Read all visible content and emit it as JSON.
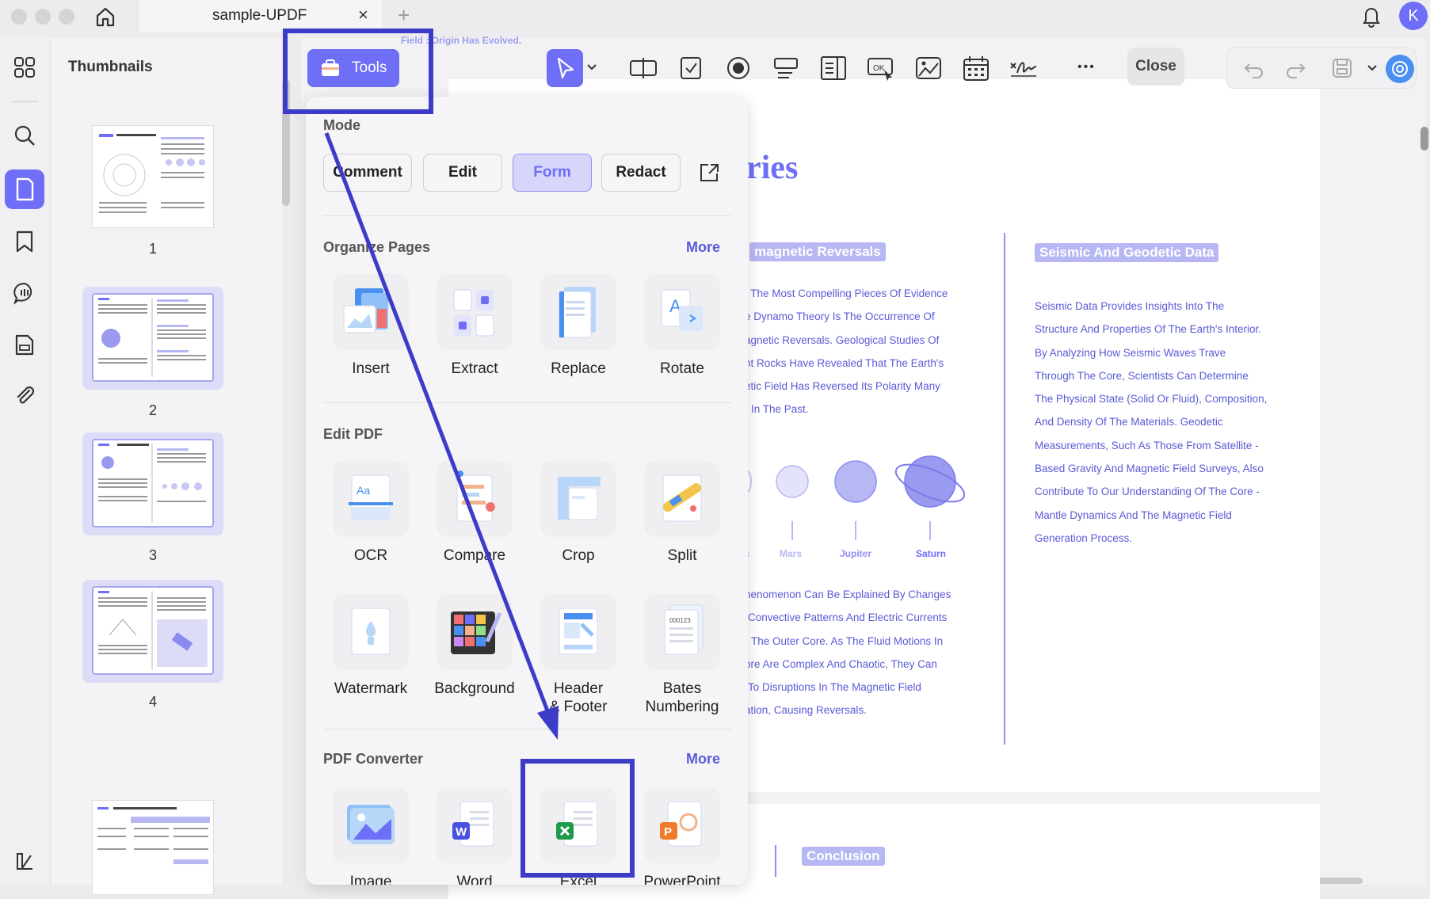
{
  "titlebar": {
    "tab_title": "sample-UPDF",
    "tab_close": "×",
    "new_tab": "+",
    "avatar_letter": "K"
  },
  "thumbnails": {
    "title": "Thumbnails",
    "pages": [
      "1",
      "2",
      "3",
      "4"
    ]
  },
  "toolbar": {
    "tools_label": "Tools",
    "close_label": "Close",
    "more_dots": "•••"
  },
  "panel": {
    "mode_title": "Mode",
    "modes": [
      "Comment",
      "Edit",
      "Form",
      "Redact"
    ],
    "selected_mode": "Form",
    "organize_title": "Organize Pages",
    "organize_more": "More",
    "organize_tools": [
      "Insert",
      "Extract",
      "Replace",
      "Rotate"
    ],
    "edit_title": "Edit PDF",
    "edit_tools_row1": [
      "OCR",
      "Compare",
      "Crop",
      "Split"
    ],
    "edit_tools_row2": [
      "Watermark",
      "Background",
      "Header\n& Footer",
      "Bates\nNumbering"
    ],
    "converter_title": "PDF Converter",
    "converter_more": "More",
    "converter_tools": [
      "Image",
      "Word",
      "Excel",
      "PowerPoint"
    ]
  },
  "document": {
    "partial_top": "Field : Origin Has Evolved.",
    "heading_partial": "ries",
    "left_banner": "magnetic Reversals",
    "left_text": [
      "f The Most Compelling Pieces Of Evidence",
      "e Dynamo Theory Is The Occurrence Of",
      "agnetic Reversals. Geological Studies Of",
      "nt Rocks Have Revealed That The Earth's",
      "etic Field Has Reversed Its Polarity Many",
      "In The Past."
    ],
    "planets": [
      "s",
      "Mars",
      "Jupiter",
      "Saturn"
    ],
    "left_text2": [
      "henomenon Can Be Explained By Changes",
      "Convective Patterns And Electric Currents",
      "The Outer Core. As The Fluid Motions In",
      "ore Are Complex And Chaotic, They Can",
      "To Disruptions In The Magnetic Field",
      "ation, Causing Reversals."
    ],
    "right_banner": "Seismic And Geodetic Data",
    "right_text": [
      "Seismic Data Provides Insights Into The",
      "Structure And Properties Of The Earth's Interior.",
      "By Analyzing How Seismic Waves Trave",
      "Through The Core, Scientists Can Determine",
      "The Physical State (Solid Or Fluid), Composition,",
      "And Density Of The Materials. Geodetic",
      "Measurements, Such As Those From Satellite -",
      "Based Gravity And Magnetic Field Surveys, Also",
      "Contribute To Our Understanding Of The Core -",
      "Mantle Dynamics And The Magnetic Field",
      "Generation Process."
    ],
    "page2_banner": "Conclusion"
  },
  "colors": {
    "accent": "#6e6ef6",
    "highlight_box": "#3c3cc8",
    "doc_text": "#5a5ad6"
  }
}
